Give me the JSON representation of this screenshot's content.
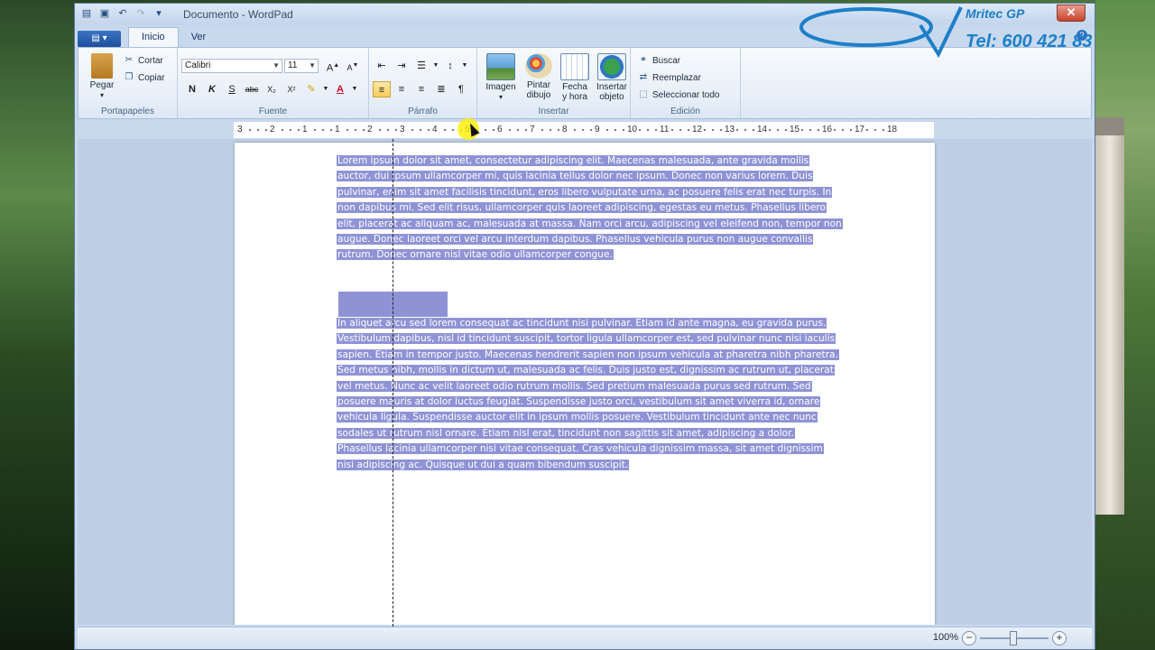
{
  "window": {
    "title": "Documento - WordPad"
  },
  "watermark": {
    "brand": "Mritec GP",
    "phone": "Tel: 600 421 830"
  },
  "tabs": [
    {
      "label": "Inicio",
      "active": true
    },
    {
      "label": "Ver",
      "active": false
    }
  ],
  "ribbon": {
    "clipboard": {
      "paste": "Pegar",
      "cut": "Cortar",
      "copy": "Copiar",
      "label": "Portapapeles"
    },
    "font": {
      "family": "Calibri",
      "size": "11",
      "label": "Fuente",
      "bold": "N",
      "italic": "K",
      "underline": "S",
      "strike": "abc",
      "subscript": "X₂",
      "superscript": "X²"
    },
    "paragraph": {
      "label": "Párrafo"
    },
    "insert": {
      "image": "Imagen",
      "paint_line1": "Pintar",
      "paint_line2": "dibujo",
      "date_line1": "Fecha",
      "date_line2": "y hora",
      "object_line1": "Insertar",
      "object_line2": "objeto",
      "label": "Insertar"
    },
    "edit": {
      "find": "Buscar",
      "replace": "Reemplazar",
      "select_all": "Seleccionar todo",
      "label": "Edición"
    }
  },
  "ruler": {
    "numbers": [
      "3",
      "2",
      "1",
      "1",
      "2",
      "3",
      "4",
      "5",
      "6",
      "7",
      "8",
      "9",
      "10",
      "11",
      "12",
      "13",
      "14",
      "15",
      "16",
      "17",
      "18"
    ]
  },
  "document": {
    "paragraph1": "Lorem ipsum dolor sit amet, consectetur adipiscing elit. Maecenas malesuada, ante gravida mollis auctor, dui ipsum ullamcorper mi, quis lacinia tellus dolor nec ipsum. Donec non varius lorem. Duis pulvinar, enim sit amet facilisis tincidunt, eros libero vulputate urna, ac posuere felis erat nec turpis. In non dapibus mi. Sed elit risus, ullamcorper quis laoreet adipiscing, egestas eu metus. Phasellus libero elit, placerat ac aliquam ac, malesuada at massa. Nam orci arcu, adipiscing vel eleifend non, tempor non augue. Donec laoreet orci vel arcu interdum dapibus. Phasellus vehicula purus non augue convallis rutrum. Donec ornare nisl vitae odio ullamcorper congue.",
    "paragraph2": "In aliquet arcu sed lorem consequat ac tincidunt nisi pulvinar. Etiam id ante magna, eu gravida purus. Vestibulum dapibus, nisl id tincidunt suscipit, tortor ligula ullamcorper est, sed pulvinar nunc nisi iaculis sapien. Etiam in tempor justo. Maecenas hendrerit sapien non ipsum vehicula at pharetra nibh pharetra. Sed metus nibh, mollis in dictum ut, malesuada ac felis. Duis justo est, dignissim ac rutrum ut, placerat vel metus. Nunc ac velit laoreet odio rutrum mollis. Sed pretium malesuada purus sed rutrum. Sed posuere mauris at dolor luctus feugiat. Suspendisse justo orci, vestibulum sit amet viverra id, ornare vehicula ligula. Suspendisse auctor elit in ipsum mollis posuere. Vestibulum tincidunt ante nec nunc sodales ut rutrum nisl ornare. Etiam nisl erat, tincidunt non sagittis sit amet, adipiscing a dolor. Phasellus lacinia ullamcorper nisi vitae consequat. Cras vehicula dignissim massa, sit amet dignissim nisi adipiscing ac. Quisque ut dui a quam bibendum suscipit."
  },
  "status": {
    "zoom": "100%",
    "zoom_level": 1.0
  },
  "colors": {
    "selection": "#8f93d6",
    "ribbon_bg": "#e8eff8",
    "highlight_cursor": "#fff000"
  }
}
